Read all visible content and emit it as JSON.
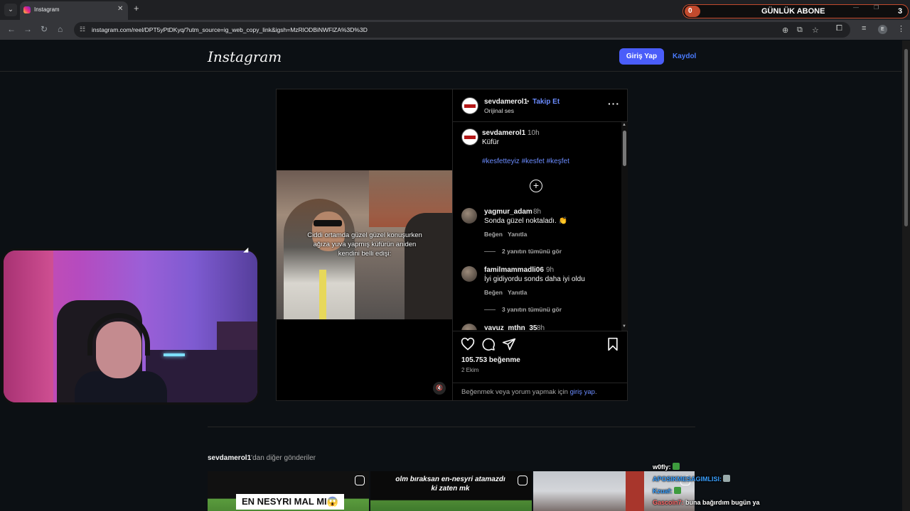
{
  "browser": {
    "tab_title": "Instagram",
    "tab_close": "✕",
    "new_tab": "+",
    "url": "instagram.com/reel/DPT5yPtDKyq/?utm_source=ig_web_copy_link&igsh=MzRlODBiNWFlZA%3D%3D",
    "profile_initial": "E",
    "win_min": "—",
    "win_max": "❐",
    "icons": [
      "back-icon",
      "forward-icon",
      "reload-icon",
      "home-icon",
      "site-info-icon",
      "zoom-icon",
      "install-icon",
      "star-icon",
      "extensions-icon",
      "tab-search-icon"
    ]
  },
  "stream_overlay": {
    "abone_count": "0",
    "abone_label": "GÜNLÜK ABONE",
    "abone_target": "3",
    "accent_color": "#c24a2d"
  },
  "header": {
    "logo": "Instagram",
    "login_label": "Giriş Yap",
    "signup_label": "Kaydol"
  },
  "post": {
    "author": "sevdamerol1",
    "follow_separator": "•",
    "follow_label": "Takip Et",
    "audio": "Orijinal ses",
    "video_caption": "Ciddi ortamda güzel güzel konuşurken ağıza yuva yapmış küfürün aniden kendini belli edişi:",
    "caption": {
      "user": "sevdamerol1",
      "time": "10h",
      "text": "Küfür",
      "hashtags": "#kesfetteyiz #kesfet #keşfet"
    },
    "comments": [
      {
        "user": "yagmur_adam",
        "time": "8h",
        "text": "Sonda güzel noktaladı. 👏",
        "like": "Beğen",
        "reply": "Yanıtla",
        "replies": "2 yanıtın tümünü gör"
      },
      {
        "user": "familmammadli06",
        "time": "9h",
        "text": "İyi gidiyordu sonds daha iyi oldu",
        "like": "Beğen",
        "reply": "Yanıtla",
        "replies": "3 yanıtın tümünü gör"
      },
      {
        "user": "yavuz_mthn_35",
        "time": "8h"
      }
    ],
    "likes": "105.753 beğenme",
    "date": "2 Ekim",
    "login_prompt_text": "Beğenmek veya yorum yapmak için ",
    "login_prompt_link": "giriş yap",
    "login_prompt_end": "."
  },
  "more_posts": {
    "user": "sevdamerol1",
    "suffix": "'dan diğer gönderiler",
    "thumb1_label": "EN NESYRI MAL MI😱",
    "thumb2_label": "olm bıraksan en-nesyri atamazdı ki zaten mk"
  },
  "chat": [
    {
      "user": "w0fly:",
      "text": "",
      "color": "#ffffff"
    },
    {
      "user": "APOSIKMESAGIMLISI:",
      "text": "",
      "color": "#3aa0ff"
    },
    {
      "user": "Kzuaf:",
      "text": "",
      "color": "#3aa0ff"
    },
    {
      "user": "Gascoin7:",
      "text": "buna bağırdım bugün ya",
      "color": "#ff6a6a"
    }
  ]
}
